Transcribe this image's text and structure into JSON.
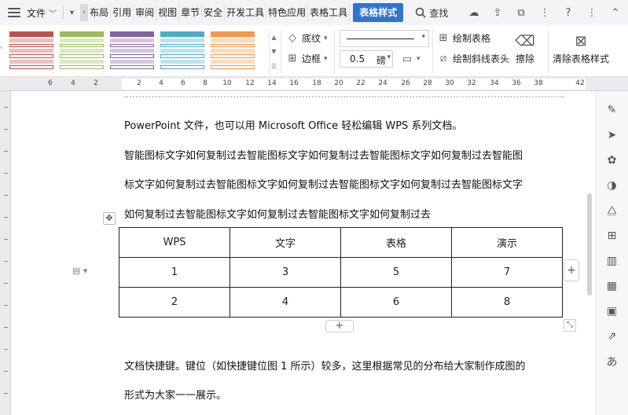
{
  "menu": {
    "file_label": "文件",
    "tabs": [
      "布局",
      "引用",
      "审阅",
      "视图",
      "章节",
      "安全",
      "开发工具",
      "特色应用",
      "表格工具"
    ],
    "active_tab": "表格样式",
    "search_label": "查找"
  },
  "ribbon": {
    "shading_label": "底纹",
    "border_label": "边框",
    "line_width_value": "0.5",
    "line_width_unit": "磅",
    "draw_table_label": "绘制表格",
    "draw_diagonal_label": "绘制斜线表头",
    "erase_label": "擦除",
    "clear_style_label": "清除表格样式",
    "style_colors": [
      "#c0504d",
      "#9bbb59",
      "#8064a2",
      "#4bacc6",
      "#f79646"
    ]
  },
  "ruler": {
    "ticks": [
      "6",
      "4",
      "2",
      "2",
      "4",
      "6",
      "8",
      "10",
      "12",
      "14",
      "16",
      "18",
      "20",
      "22",
      "24",
      "26",
      "28",
      "30",
      "32",
      "34",
      "36",
      "38",
      "42"
    ]
  },
  "document": {
    "line0": "PowerPoint 文件，也可以用 Microsoft Office 轻松编辑 WPS 系列文档。",
    "line1": "智能图标文字如何复制过去智能图标文字如何复制过去智能图标文字如何复制过去智能图",
    "line2": "标文字如何复制过去智能图标文字如何复制过去智能图标文字如何复制过去智能图标文字",
    "line3": "如何复制过去智能图标文字如何复制过去智能图标文字如何复制过去",
    "line4": "文档快捷键。键位（如快捷键位图 1 所示）较多，这里根据常见的分布给大家制作成图的",
    "line5": "形式为大家一一展示。",
    "table": [
      [
        "WPS",
        "文字",
        "表格",
        "演示"
      ],
      [
        "1",
        "3",
        "5",
        "7"
      ],
      [
        "2",
        "4",
        "6",
        "8"
      ]
    ]
  }
}
